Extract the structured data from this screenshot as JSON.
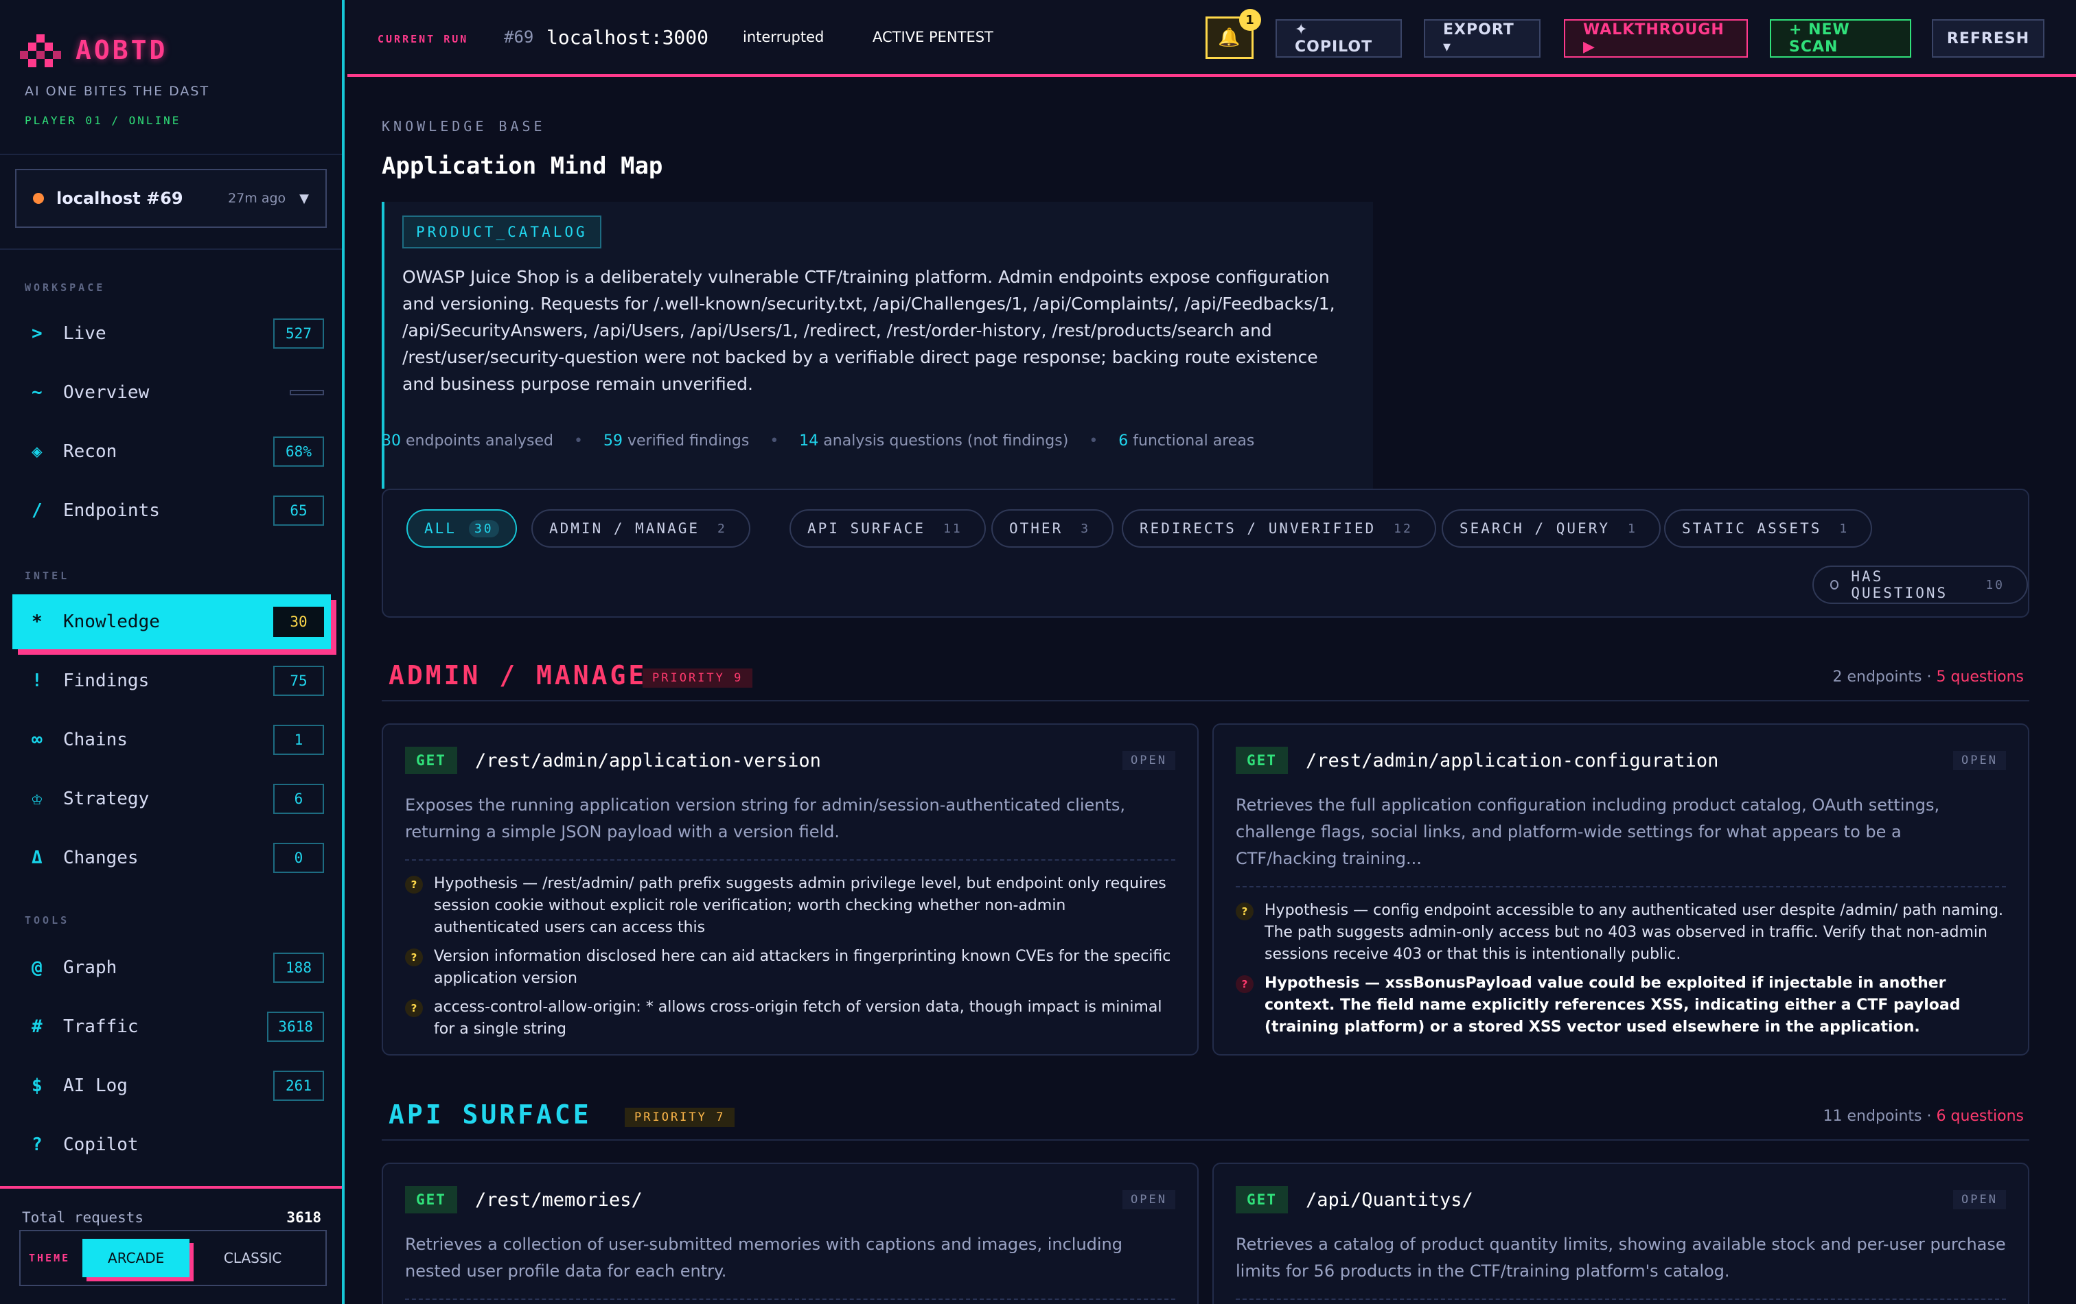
{
  "brand": {
    "name": "AOBTD",
    "tagline": "AI ONE BITES THE DAST",
    "status": "PLAYER 01 / ONLINE",
    "accent": "#ff3a8c"
  },
  "target": {
    "name": "localhost #69",
    "time": "27m ago",
    "status_color": "#ff8a3a"
  },
  "sidebar": {
    "sections": {
      "workspace": "WORKSPACE",
      "intel": "INTEL",
      "tools": "TOOLS"
    },
    "items": [
      {
        "icon": ">",
        "label": "Live",
        "count": "527"
      },
      {
        "icon": "~",
        "label": "Overview",
        "count": ""
      },
      {
        "icon": "◈",
        "label": "Recon",
        "count": "68%"
      },
      {
        "icon": "/",
        "label": "Endpoints",
        "count": "65"
      },
      {
        "icon": "*",
        "label": "Knowledge",
        "count": "30",
        "active": true
      },
      {
        "icon": "!",
        "label": "Findings",
        "count": "75"
      },
      {
        "icon": "∞",
        "label": "Chains",
        "count": "1"
      },
      {
        "icon": "♔",
        "label": "Strategy",
        "count": "6"
      },
      {
        "icon": "Δ",
        "label": "Changes",
        "count": "0"
      },
      {
        "icon": "@",
        "label": "Graph",
        "count": "188"
      },
      {
        "icon": "#",
        "label": "Traffic",
        "count": "3618"
      },
      {
        "icon": "$",
        "label": "AI Log",
        "count": "261"
      },
      {
        "icon": "?",
        "label": "Copilot",
        "count": ""
      }
    ],
    "total_requests_label": "Total requests",
    "total_requests_value": "3618",
    "theme_label": "THEME",
    "theme_options": [
      "ARCADE",
      "CLASSIC"
    ],
    "theme_selected": "ARCADE"
  },
  "topbar": {
    "run_label": "CURRENT RUN",
    "run_number": "#69",
    "run_host": "localhost:3000",
    "run_status": "interrupted",
    "run_mode": "ACTIVE PENTEST",
    "notifications": "1",
    "buttons": {
      "copilot": "✦ COPILOT",
      "export": "EXPORT ▾",
      "walkthrough": "WALKTHROUGH ▶",
      "new_scan": "+ NEW SCAN",
      "refresh": "REFRESH"
    }
  },
  "main": {
    "kb_label": "KNOWLEDGE BASE",
    "title": "Application Mind Map",
    "summary_chip": "PRODUCT_CATALOG",
    "summary_text": "OWASP Juice Shop is a deliberately vulnerable CTF/training platform. Admin endpoints expose configuration and versioning. Requests for /.well-known/security.txt, /api/Challenges/1, /api/Complaints/, /api/Feedbacks/1, /api/SecurityAnswers, /api/Users, /api/Users/1, /redirect, /rest/order-history, /rest/products/search and /rest/user/security-question were not backed by a verifiable direct page response; backing route existence and business purpose remain unverified.",
    "stats": [
      {
        "n": "30",
        "label": "endpoints analysed"
      },
      {
        "n": "59",
        "label": "verified findings"
      },
      {
        "n": "14",
        "label": "analysis questions (not findings)"
      },
      {
        "n": "6",
        "label": "functional areas"
      }
    ],
    "filters": [
      {
        "label": "ALL",
        "count": "30",
        "active": true
      },
      {
        "label": "ADMIN / MANAGE",
        "count": "2"
      },
      {
        "label": "API SURFACE",
        "count": "11"
      },
      {
        "label": "OTHER",
        "count": "3"
      },
      {
        "label": "REDIRECTS / UNVERIFIED",
        "count": "12"
      },
      {
        "label": "SEARCH / QUERY",
        "count": "1"
      },
      {
        "label": "STATIC ASSETS",
        "count": "1"
      }
    ],
    "has_questions": {
      "label": "HAS QUESTIONS",
      "count": "10"
    },
    "areas": [
      {
        "title": "ADMIN / MANAGE",
        "priority": "PRIORITY 9",
        "color": "#ff3a6e",
        "endpoints_label": "2 endpoints",
        "questions_label": "5 questions",
        "cards": [
          {
            "method": "GET",
            "path": "/rest/admin/application-version",
            "status": "OPEN",
            "desc": "Exposes the running application version string for admin/session-authenticated clients, returning a simple JSON payload with a version field.",
            "hypotheses": [
              {
                "text": "Hypothesis — /rest/admin/ path prefix suggests admin privilege level, but endpoint only requires session cookie without explicit role verification; worth checking whether non-admin authenticated users can access this"
              },
              {
                "text": "Version information disclosed here can aid attackers in fingerprinting known CVEs for the specific application version"
              },
              {
                "text": "access-control-allow-origin: * allows cross-origin fetch of version data, though impact is minimal for a single string"
              }
            ]
          },
          {
            "method": "GET",
            "path": "/rest/admin/application-configuration",
            "status": "OPEN",
            "desc": "Retrieves the full application configuration including product catalog, OAuth settings, challenge flags, social links, and platform-wide settings for what appears to be a CTF/hacking training...",
            "hypotheses": [
              {
                "text": "Hypothesis — config endpoint accessible to any authenticated user despite /admin/ path naming. The path suggests admin-only access but no 403 was observed in traffic. Verify that non-admin sessions receive 403 or that this is intentionally public."
              },
              {
                "text": "Hypothesis — xssBonusPayload value could be exploited if injectable in another context. The field name explicitly references XSS, indicating either a CTF payload (training platform) or a stored XSS vector used elsewhere in the application.",
                "strong": true
              }
            ]
          }
        ]
      },
      {
        "title": "API SURFACE",
        "priority": "PRIORITY 7",
        "color": "#21d7ef",
        "endpoints_label": "11 endpoints",
        "questions_label": "6 questions",
        "cards": [
          {
            "method": "GET",
            "path": "/rest/memories/",
            "status": "OPEN",
            "desc": "Retrieves a collection of user-submitted memories with captions and images, including nested user profile data for each entry."
          },
          {
            "method": "GET",
            "path": "/api/Quantitys/",
            "status": "OPEN",
            "desc": "Retrieves a catalog of product quantity limits, showing available stock and per-user purchase limits for 56 products in the CTF/training platform's catalog."
          }
        ]
      }
    ]
  }
}
